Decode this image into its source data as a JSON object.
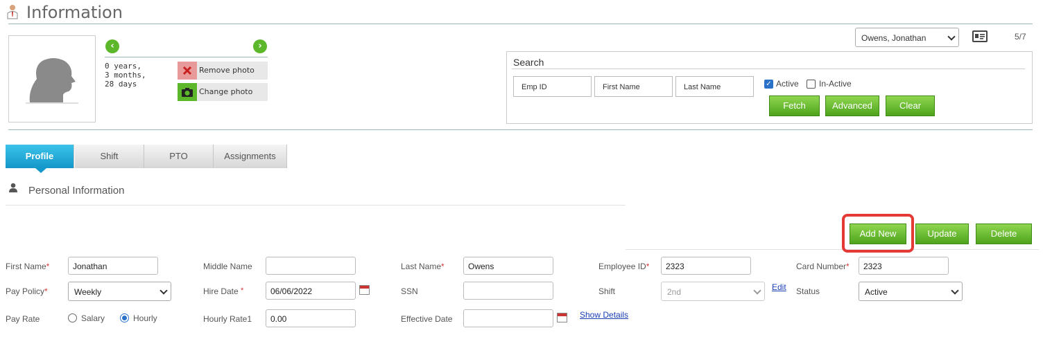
{
  "header": {
    "title": "Information"
  },
  "profile": {
    "tenure": "0 years,\n3 months,\n28 days",
    "remove_photo": "Remove photo",
    "change_photo": "Change photo"
  },
  "employee_selector": {
    "selected": "Owens, Jonathan",
    "counter": "5/7"
  },
  "search": {
    "title": "Search",
    "emp_id_placeholder": "Emp ID",
    "first_name_placeholder": "First Name",
    "last_name_placeholder": "Last Name",
    "active_label": "Active",
    "active_checked": true,
    "inactive_label": "In-Active",
    "inactive_checked": false,
    "fetch": "Fetch",
    "advanced": "Advanced",
    "clear": "Clear"
  },
  "tabs": [
    {
      "label": "Profile",
      "active": true
    },
    {
      "label": "Shift",
      "active": false
    },
    {
      "label": "PTO",
      "active": false
    },
    {
      "label": "Assignments",
      "active": false
    }
  ],
  "section": {
    "title": "Personal Information"
  },
  "actions": {
    "add_new": "Add New",
    "update": "Update",
    "delete": "Delete"
  },
  "form": {
    "first_name": {
      "label": "First Name",
      "required": "*",
      "value": "Jonathan"
    },
    "middle_name": {
      "label": "Middle Name",
      "value": ""
    },
    "last_name": {
      "label": "Last Name",
      "required": "*",
      "value": "Owens"
    },
    "employee_id": {
      "label": "Employee ID",
      "required": "*",
      "value": "2323"
    },
    "card_number": {
      "label": "Card Number",
      "required": "*",
      "value": "2323"
    },
    "pay_policy": {
      "label": "Pay Policy",
      "required": "*",
      "value": "Weekly"
    },
    "hire_date": {
      "label": "Hire Date",
      "required": "*",
      "value": "06/06/2022"
    },
    "ssn": {
      "label": "SSN",
      "value": ""
    },
    "shift": {
      "label": "Shift",
      "value": "2nd",
      "edit_link": "Edit"
    },
    "status": {
      "label": "Status",
      "value": "Active"
    },
    "pay_rate": {
      "label": "Pay Rate",
      "salary": "Salary",
      "hourly": "Hourly",
      "selected": "Hourly"
    },
    "hourly_rate1": {
      "label": "Hourly Rate1",
      "value": "0.00"
    },
    "effective_date": {
      "label": "Effective Date",
      "value": "",
      "show_details": "Show Details"
    }
  },
  "colors": {
    "accent_green": "#5cb82a",
    "tab_active": "#1497c9",
    "highlight": "#e53935",
    "link": "#1a3fb6"
  }
}
